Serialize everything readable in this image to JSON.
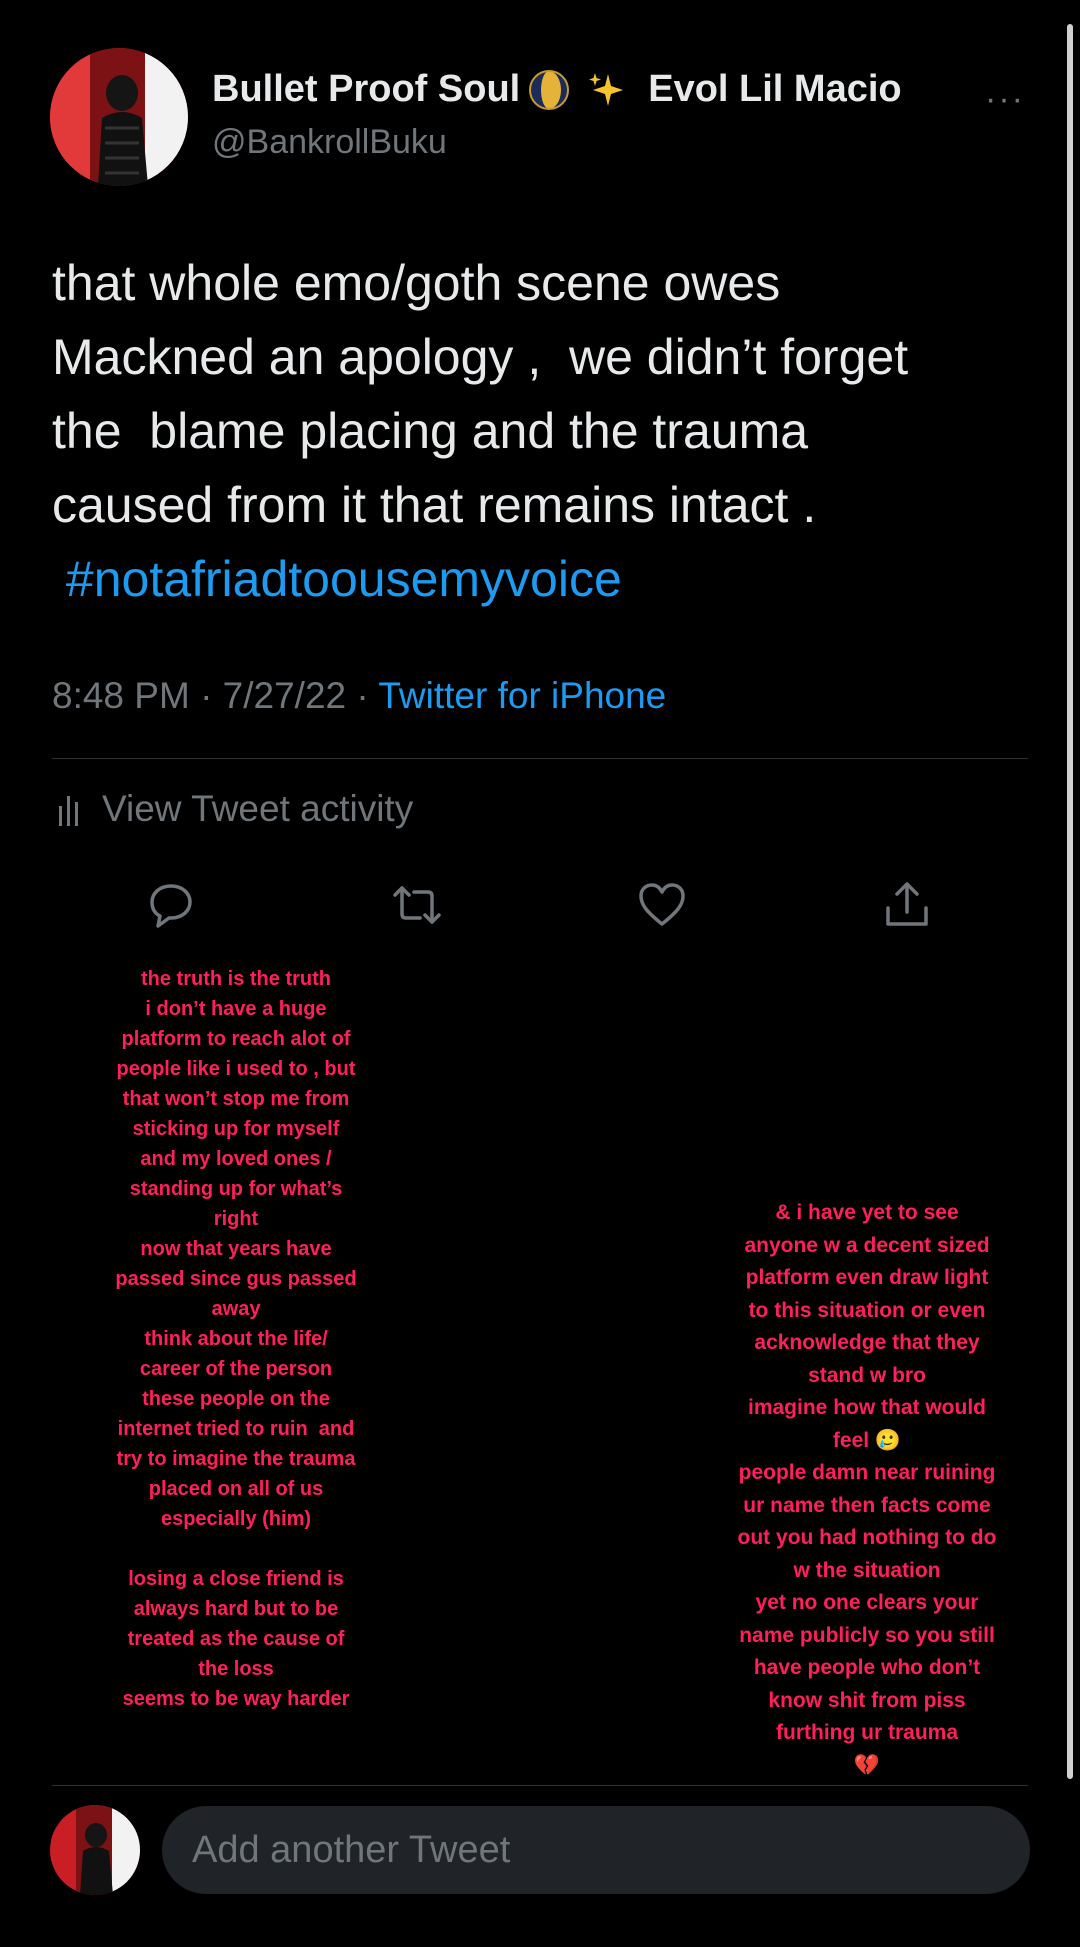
{
  "tweet": {
    "display_name_part1": "Bullet Proof Soul",
    "display_name_part2": "Evol Lil Macio",
    "name_emojis": [
      "moon-icon",
      "sparkles-icon"
    ],
    "handle": "@BankrollBuku",
    "more_label": "···",
    "text_lines": [
      "that whole emo/goth scene owes",
      "Mackned an apology ,  we didn’t forget",
      "the  blame placing and the trauma",
      "caused from it that remains intact ."
    ],
    "hashtag": " #notafriadtoousemyvoice",
    "time": "8:48 PM · 7/27/22 · ",
    "source": "Twitter for iPhone",
    "activity_label": "View Tweet activity"
  },
  "actions": {
    "icons": [
      "reply-icon",
      "retweet-icon",
      "like-icon",
      "share-icon"
    ]
  },
  "overlay_left": [
    "the truth is the truth",
    "i don’t have a huge",
    "platform to reach alot of",
    "people like i used to , but",
    "that won’t stop me from",
    "sticking up for myself",
    "and my loved ones /",
    "standing up for what’s",
    "right",
    "now that years have",
    "passed since gus passed",
    "away",
    "think about the life/",
    "career of the person",
    "these people on the",
    "internet tried to ruin  and",
    "try to imagine the trauma",
    "placed on all of us",
    "especially (him)",
    "",
    "losing a close friend is",
    "always hard but to be",
    "treated as the cause of",
    "the loss",
    "seems to be way harder"
  ],
  "overlay_right": [
    "& i have yet to see",
    "anyone w a decent sized",
    "platform even draw light",
    "to this situation or even",
    "acknowledge that they",
    "stand w bro",
    "imagine how that would",
    "feel 🥲",
    "people damn near ruining",
    "ur name then facts come",
    "out you had nothing to do",
    "w the situation",
    "yet no one clears your",
    "name publicly so you still",
    "have people who don’t",
    "know shit from piss",
    "furthing ur trauma",
    "💔"
  ],
  "reply": {
    "placeholder": "Add another Tweet"
  },
  "colors": {
    "background": "#000000",
    "text": "#e7e9ea",
    "muted": "#71767b",
    "link": "#1d9bf0",
    "overlay": "#ff1f5a"
  }
}
